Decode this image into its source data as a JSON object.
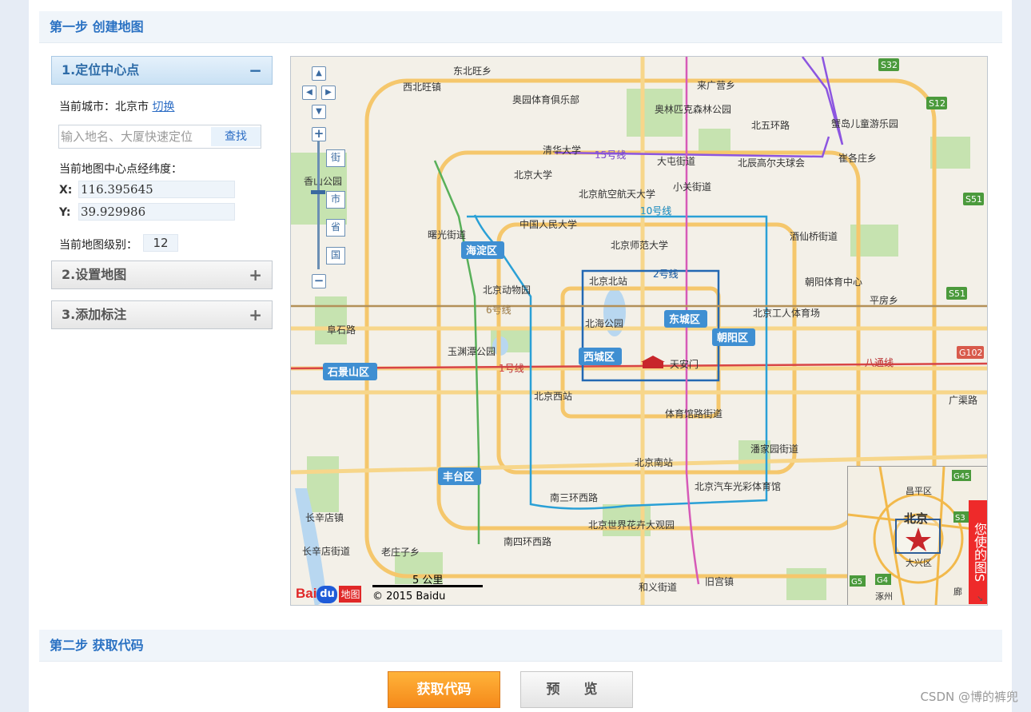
{
  "step1": {
    "title": "第一步 创建地图"
  },
  "panels": [
    {
      "label": "1.定位中心点",
      "toggle": "−",
      "open": true
    },
    {
      "label": "2.设置地图",
      "toggle": "+"
    },
    {
      "label": "3.添加标注",
      "toggle": "+"
    }
  ],
  "locate": {
    "city_label": "当前城市：北京市",
    "switch_link": "切换",
    "search_placeholder": "输入地名、大厦快速定位",
    "search_button": "查找",
    "center_label": "当前地图中心点经纬度：",
    "x_label": "X:",
    "x_value": "116.395645",
    "y_label": "Y:",
    "y_value": "39.929986",
    "zoom_label": "当前地图级别：",
    "zoom_value": "12"
  },
  "map": {
    "zoom_controls": {
      "in": "+",
      "out": "−"
    },
    "level_buttons": [
      "街",
      "市",
      "省",
      "国"
    ],
    "districts": [
      "海淀区",
      "东城区",
      "西城区",
      "朝阳区",
      "石景山区",
      "丰台区"
    ],
    "places": [
      "东北旺乡",
      "西北旺镇",
      "奥园体育俱乐部",
      "来广营乡",
      "奥林匹克森林公园",
      "北五环路",
      "蟹岛儿童游乐园",
      "清华大学",
      "15号线",
      "大屯街道",
      "北辰高尔夫球会",
      "崔各庄乡",
      "北京大学",
      "北京航空航天大学",
      "小关街道",
      "香山公园",
      "10号线",
      "中国人民大学",
      "酒仙桥街道",
      "曙光街道",
      "北京师范大学",
      "2号线",
      "北京北站",
      "朝阳体育中心",
      "北京动物园",
      "6号线",
      "平房乡",
      "北海公园",
      "北京工人体育场",
      "阜石路",
      "玉渊潭公园",
      "天安门",
      "1号线",
      "八通线",
      "北京西站",
      "广渠路",
      "体育馆路街道",
      "潘家园街道",
      "北京南站",
      "南三环西路",
      "北京汽车光彩体育馆",
      "长辛店镇",
      "北京世界花卉大观园",
      "长辛店街道",
      "南四环西路",
      "老庄子乡",
      "和义街道",
      "旧宫镇",
      "昌平区",
      "北京",
      "大兴区",
      "涿州",
      "廊"
    ],
    "shields": [
      "S32",
      "S12",
      "S51",
      "S51",
      "G102",
      "G45",
      "S3",
      "G5",
      "G4"
    ],
    "scale_label": "5 公里",
    "copyright": "© 2015 Baidu",
    "logo_text": "Bai",
    "logo_du": "du",
    "logo_suffix": "地图",
    "side_banner": "您使的图S"
  },
  "step2": {
    "title": "第二步 获取代码"
  },
  "buttons": {
    "get_code": "获取代码",
    "preview": "预 览"
  },
  "watermark": "CSDN @博的裤兜",
  "colors": {
    "accent": "#2b72c3",
    "orange_button": "#f5891a",
    "line_10": "#2aa0d6",
    "line_1": "#d84545"
  }
}
